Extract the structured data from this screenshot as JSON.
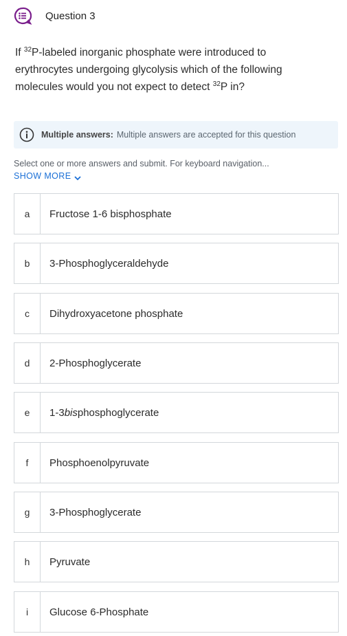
{
  "header": {
    "title": "Question 3",
    "icon": "question-list-icon",
    "icon_color": "#7a1e8c"
  },
  "question": {
    "part1": "If ",
    "sup1": "32",
    "part2": "P-labeled inorganic phosphate were introduced to erythrocytes undergoing glycolysis which of the following molecules would you not expect to detect ",
    "sup2": "32",
    "part3": "P in?"
  },
  "notice": {
    "icon": "info-icon",
    "strong": "Multiple answers:",
    "text": "Multiple answers are accepted for this question"
  },
  "instructions": "Select one or more answers and submit. For keyboard navigation...",
  "show_more": {
    "label": "SHOW MORE",
    "icon": "chevron-down-icon",
    "color": "#1a6fd6"
  },
  "options": [
    {
      "letter": "a",
      "text": "Fructose 1-6 bisphosphate"
    },
    {
      "letter": "b",
      "text": "3-Phosphoglyceraldehyde"
    },
    {
      "letter": "c",
      "text": "Dihydroxyacetone phosphate"
    },
    {
      "letter": "d",
      "text": "2-Phosphoglycerate"
    },
    {
      "letter": "e",
      "text_prefix": "1-3 ",
      "text_italic": "bis",
      "text_suffix": "phosphoglycerate"
    },
    {
      "letter": "f",
      "text": "Phosphoenolpyruvate"
    },
    {
      "letter": "g",
      "text": "3-Phosphoglycerate"
    },
    {
      "letter": "h",
      "text": "Pyruvate"
    },
    {
      "letter": "i",
      "text": "Glucose 6-Phosphate"
    }
  ]
}
